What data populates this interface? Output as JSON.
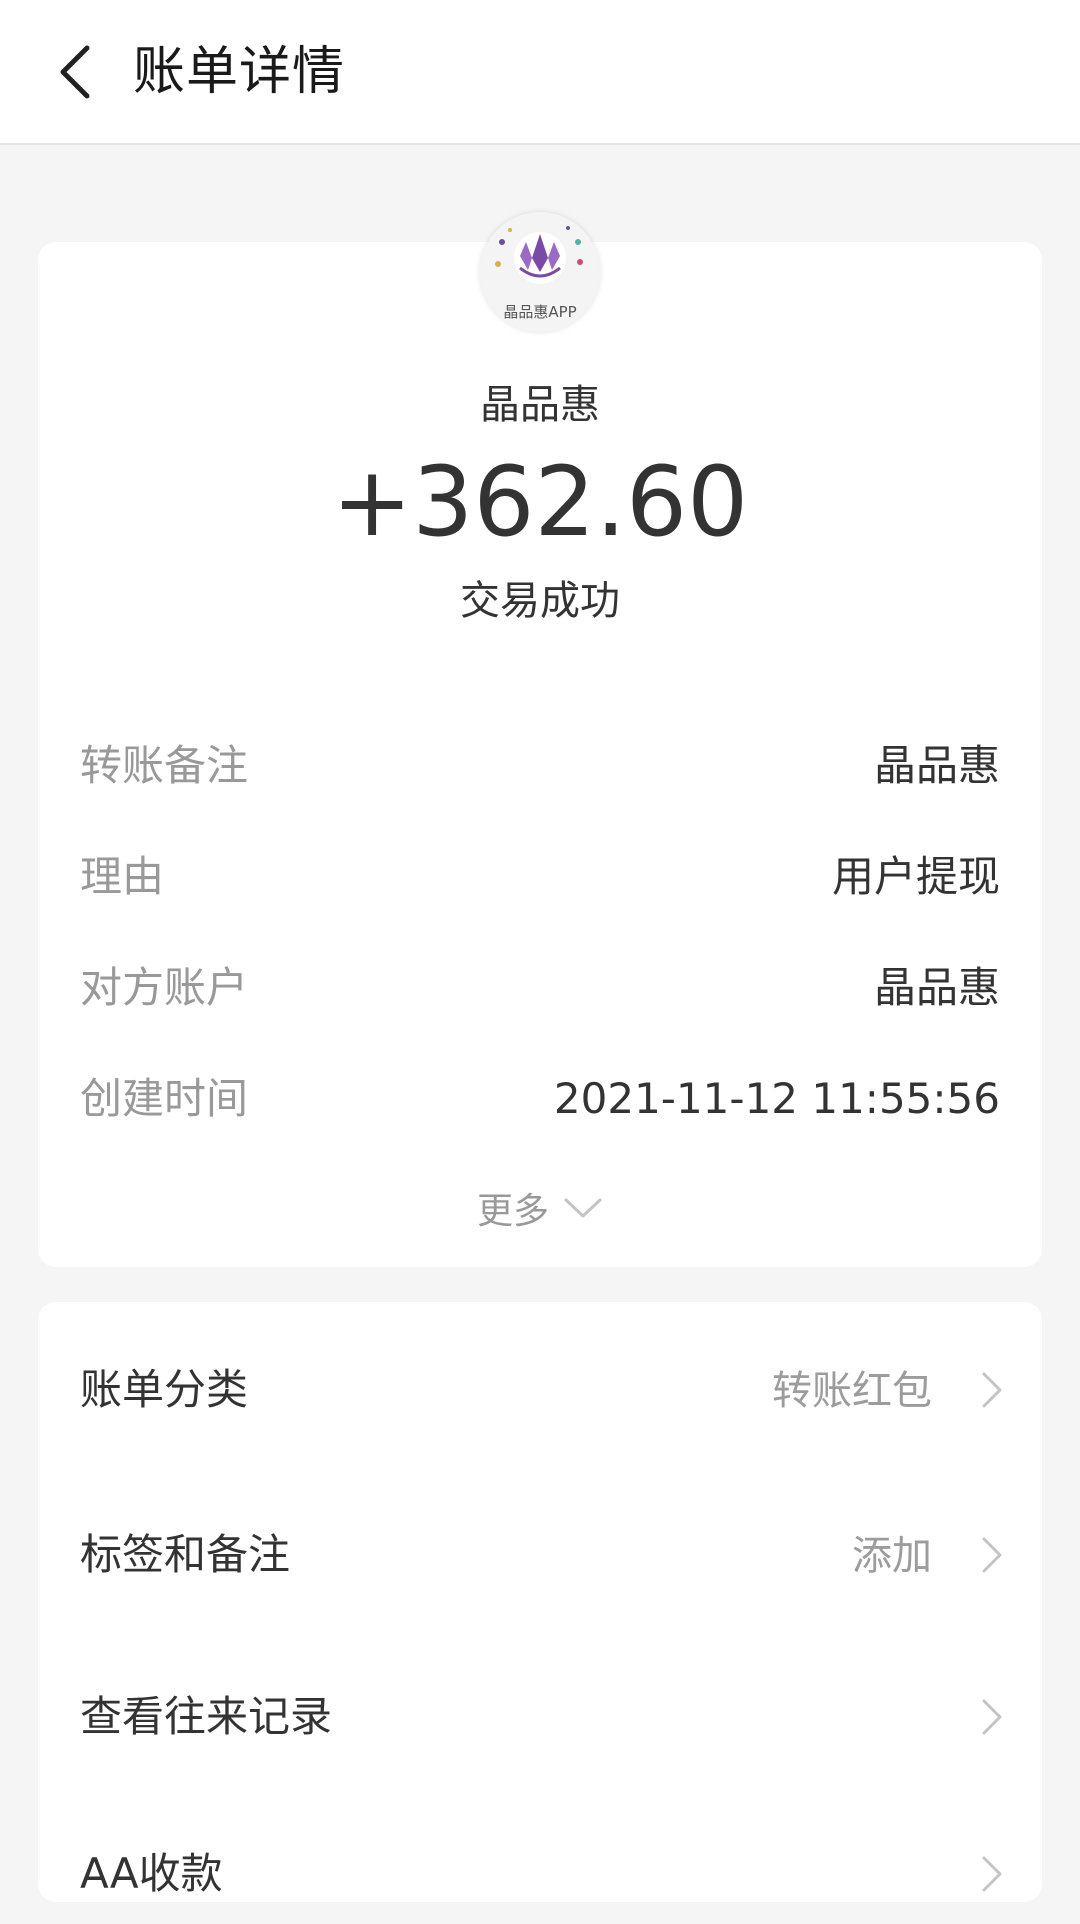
{
  "header": {
    "title": "账单详情",
    "back_icon": "back-arrow-icon"
  },
  "summary": {
    "logo_caption": "晶品惠APP",
    "merchant_name": "晶品惠",
    "amount": "+362.60",
    "status": "交易成功"
  },
  "details": [
    {
      "label": "转账备注",
      "value": "晶品惠"
    },
    {
      "label": "理由",
      "value": "用户提现"
    },
    {
      "label": "对方账户",
      "value": "晶品惠"
    },
    {
      "label": "创建时间",
      "value": "2021-11-12 11:55:56"
    }
  ],
  "more": {
    "label": "更多",
    "icon": "chevron-down-icon"
  },
  "actions": [
    {
      "label": "账单分类",
      "value": "转账红包"
    },
    {
      "label": "标签和备注",
      "value": "添加"
    },
    {
      "label": "查看往来记录",
      "value": ""
    },
    {
      "label": "AA收款",
      "value": ""
    }
  ],
  "colors": {
    "logo_purple": "#7b4aa8",
    "label_gray": "#999999",
    "text_dark": "#333333"
  }
}
